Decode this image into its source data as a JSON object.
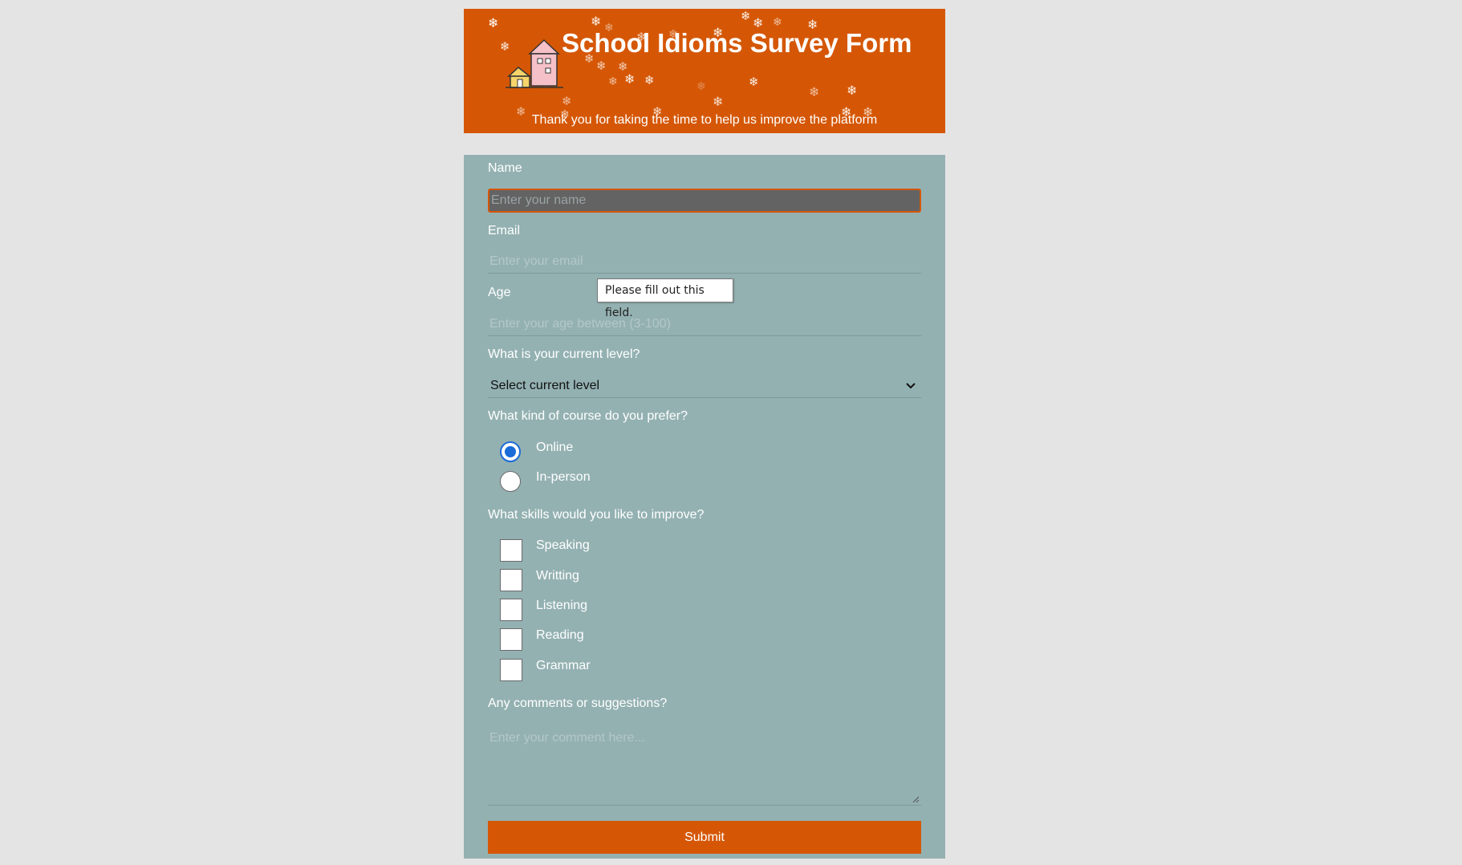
{
  "header": {
    "title": "School Idioms Survey Form",
    "subtitle": "Thank you for taking the time to help us improve the platform",
    "decoration": "snowflake-icon",
    "logo": "house-icon"
  },
  "form": {
    "name": {
      "label": "Name",
      "placeholder": "Enter your name"
    },
    "email": {
      "label": "Email",
      "placeholder": "Enter your email"
    },
    "age": {
      "label": "Age",
      "placeholder": "Enter your age between (3-100)"
    },
    "validation_tooltip": "Please fill out this field.",
    "level": {
      "label": "What is your current level?",
      "selected": "Select current level"
    },
    "course": {
      "label": "What kind of course do you prefer?",
      "options": [
        {
          "label": "Online",
          "checked": true
        },
        {
          "label": "In-person",
          "checked": false
        }
      ]
    },
    "skills": {
      "label": "What skills would you like to improve?",
      "options": [
        {
          "label": "Speaking",
          "checked": false
        },
        {
          "label": "Writting",
          "checked": false
        },
        {
          "label": "Listening",
          "checked": false
        },
        {
          "label": "Reading",
          "checked": false
        },
        {
          "label": "Grammar",
          "checked": false
        }
      ]
    },
    "comments": {
      "label": "Any comments or suggestions?",
      "placeholder": "Enter your comment here..."
    },
    "submit_label": "Submit"
  },
  "colors": {
    "accent": "#d55705",
    "form_bg": "#94b1b2",
    "page_bg": "#e4e4e4",
    "radio_checked": "#1a6cd8"
  }
}
